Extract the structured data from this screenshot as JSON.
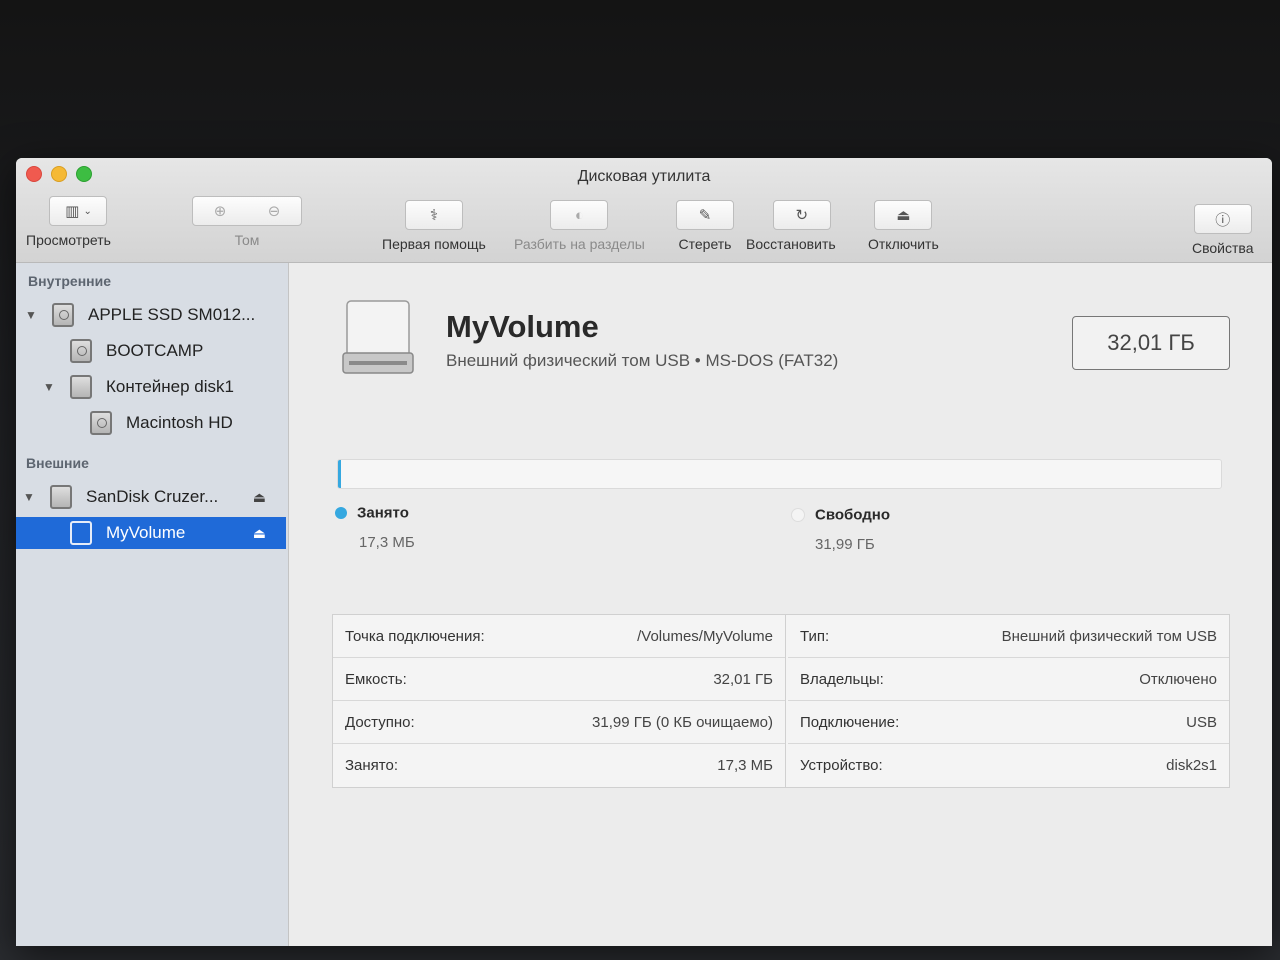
{
  "window": {
    "title": "Дисковая утилита"
  },
  "toolbar": {
    "view_label": "Просмотреть",
    "volume_label": "Том",
    "first_aid_label": "Первая помощь",
    "partition_label": "Разбить на разделы",
    "erase_label": "Стереть",
    "restore_label": "Восстановить",
    "unmount_label": "Отключить",
    "info_label": "Свойства"
  },
  "sidebar": {
    "internal_header": "Внутренние",
    "external_header": "Внешние",
    "items": [
      {
        "label": "APPLE SSD SM012..."
      },
      {
        "label": "BOOTCAMP"
      },
      {
        "label": "Контейнер disk1"
      },
      {
        "label": "Macintosh HD"
      },
      {
        "label": "SanDisk Cruzer..."
      },
      {
        "label": "MyVolume"
      }
    ]
  },
  "volume": {
    "name": "MyVolume",
    "description": "Внешний физический том USB • MS-DOS (FAT32)",
    "capacity": "32,01 ГБ"
  },
  "usage": {
    "used_fraction": 0.0005,
    "used_label": "Занято",
    "used_value": "17,3 МБ",
    "used_color": "#35a8e0",
    "free_label": "Свободно",
    "free_value": "31,99 ГБ",
    "free_color": "#f4f4f4"
  },
  "info": {
    "left": [
      {
        "key": "Точка подключения:",
        "value": "/Volumes/MyVolume"
      },
      {
        "key": "Емкость:",
        "value": "32,01 ГБ"
      },
      {
        "key": "Доступно:",
        "value": "31,99 ГБ (0 КБ очищаемо)"
      },
      {
        "key": "Занято:",
        "value": "17,3 МБ"
      }
    ],
    "right": [
      {
        "key": "Тип:",
        "value": "Внешний физический том USB"
      },
      {
        "key": "Владельцы:",
        "value": "Отключено"
      },
      {
        "key": "Подключение:",
        "value": "USB"
      },
      {
        "key": "Устройство:",
        "value": "disk2s1"
      }
    ]
  }
}
